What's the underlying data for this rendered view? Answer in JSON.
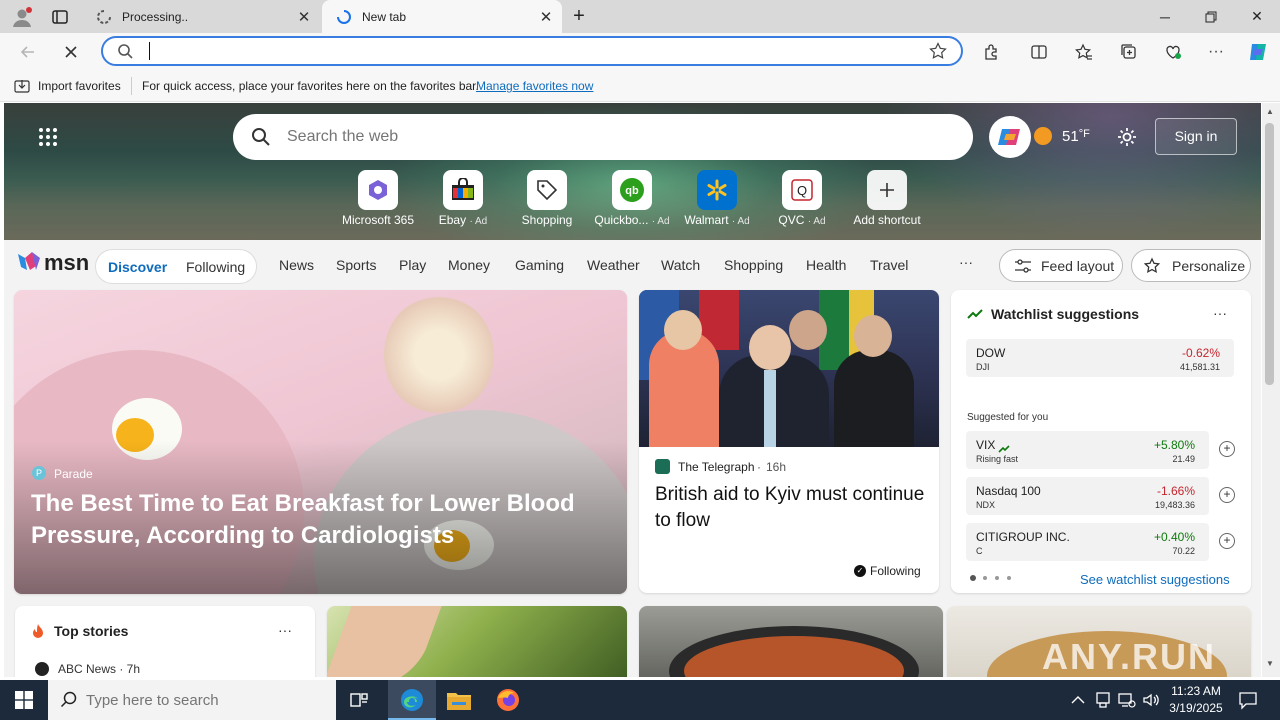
{
  "browser": {
    "tabs": [
      {
        "label": "Processing..",
        "state": "inactive"
      },
      {
        "label": "New tab",
        "state": "active"
      }
    ],
    "address": {
      "value": "",
      "placeholder": ""
    }
  },
  "favorites_bar": {
    "import_label": "Import favorites",
    "hint": "For quick access, place your favorites here on the favorites bar.",
    "manage_link": "Manage favorites now"
  },
  "hero": {
    "search_placeholder": "Search the web",
    "weather_temp": "51",
    "weather_unit": "°F",
    "sign_in": "Sign in",
    "shortcuts": [
      {
        "label": "Microsoft 365",
        "ad": ""
      },
      {
        "label": "Ebay",
        "ad": "· Ad"
      },
      {
        "label": "Shopping",
        "ad": ""
      },
      {
        "label": "Quickbo...",
        "ad": "· Ad"
      },
      {
        "label": "Walmart",
        "ad": "· Ad"
      },
      {
        "label": "QVC",
        "ad": "· Ad"
      },
      {
        "label": "Add shortcut",
        "ad": ""
      }
    ]
  },
  "msn_nav": {
    "brand": "msn",
    "discover": "Discover",
    "following": "Following",
    "items": [
      "News",
      "Sports",
      "Play",
      "Money",
      "Gaming",
      "Weather",
      "Watch",
      "Shopping",
      "Health",
      "Travel"
    ],
    "more": "···",
    "feed_layout": "Feed layout",
    "personalize": "Personalize"
  },
  "feed": {
    "hero_card": {
      "source": "Parade",
      "title": "The Best Time to Eat Breakfast for Lower Blood Pressure, According to Cardiologists"
    },
    "news_card": {
      "source": "The Telegraph",
      "age": "16h",
      "title": "British aid to Kyiv must continue to flow",
      "following": "Following"
    },
    "top_stories": {
      "title": "Top stories",
      "more": "···",
      "first_source": "ABC News · 7h"
    }
  },
  "watchlist": {
    "title": "Watchlist suggestions",
    "more": "···",
    "top": {
      "name": "DOW",
      "symbol": "DJI",
      "change": "-0.62%",
      "price": "41,581.31"
    },
    "suggested_label": "Suggested for you",
    "suggestions": [
      {
        "name": "VIX",
        "symbol": "Rising fast",
        "change": "+5.80%",
        "price": "21.49"
      },
      {
        "name": "Nasdaq 100",
        "symbol": "NDX",
        "change": "-1.66%",
        "price": "19,483.36"
      },
      {
        "name": "CITIGROUP INC.",
        "symbol": "C",
        "change": "+0.40%",
        "price": "70.22"
      }
    ],
    "see_more": "See watchlist suggestions"
  },
  "taskbar": {
    "search_placeholder": "Type here to search",
    "time": "11:23 AM",
    "date": "3/19/2025"
  },
  "colors": {
    "accent": "#0f6cbd",
    "taskbar": "#1c2a3b",
    "negative": "#c4262e",
    "positive": "#0e7a0d"
  }
}
